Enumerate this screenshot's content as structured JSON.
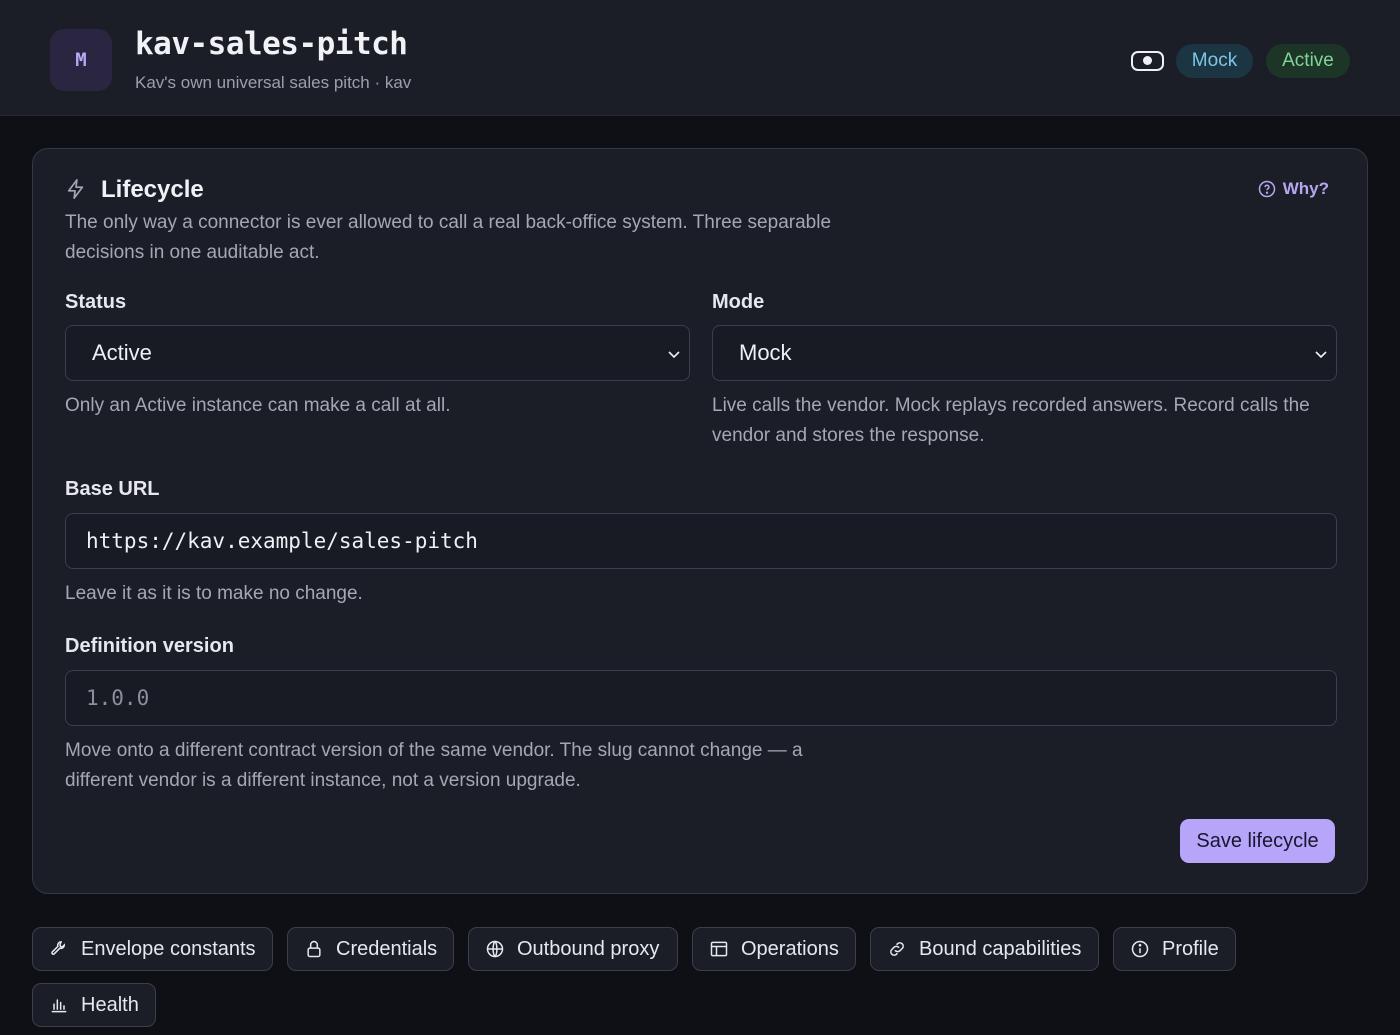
{
  "header": {
    "avatar_letter": "M",
    "title": "kav-sales-pitch",
    "subtitle": "Kav's own universal sales pitch · kav",
    "badges": {
      "mode": "Mock",
      "status": "Active"
    }
  },
  "lifecycle": {
    "title": "Lifecycle",
    "why_label": "Why?",
    "description": "The only way a connector is ever allowed to call a real back-office system. Three separable decisions in one auditable act.",
    "status": {
      "label": "Status",
      "value": "Active",
      "helper": "Only an Active instance can make a call at all."
    },
    "mode": {
      "label": "Mode",
      "value": "Mock",
      "helper": "Live calls the vendor. Mock replays recorded answers. Record calls the vendor and stores the response."
    },
    "base_url": {
      "label": "Base URL",
      "value": "https://kav.example/sales-pitch",
      "helper": "Leave it as it is to make no change."
    },
    "definition_version": {
      "label": "Definition version",
      "placeholder": "1.0.0",
      "helper": "Move onto a different contract version of the same vendor. The slug cannot change — a different vendor is a different instance, not a version upgrade."
    },
    "save_label": "Save lifecycle"
  },
  "tabs": [
    {
      "label": "Envelope constants",
      "icon": "wrench-icon"
    },
    {
      "label": "Credentials",
      "icon": "lock-icon"
    },
    {
      "label": "Outbound proxy",
      "icon": "globe-icon"
    },
    {
      "label": "Operations",
      "icon": "table-icon"
    },
    {
      "label": "Bound capabilities",
      "icon": "link-icon"
    },
    {
      "label": "Profile",
      "icon": "info-icon"
    },
    {
      "label": "Health",
      "icon": "bar-chart-icon"
    }
  ],
  "colors": {
    "accent": "#b6a5f8",
    "mock_badge": "#7cc6e8",
    "active_badge": "#7fd49a"
  }
}
